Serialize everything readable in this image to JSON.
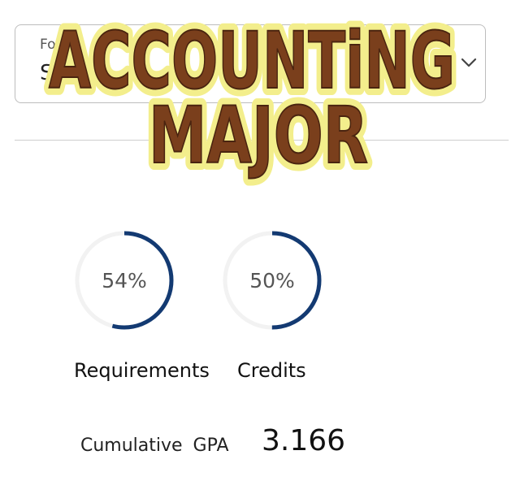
{
  "dropdown": {
    "label_partial": "Fo",
    "value_partial": "S"
  },
  "title": {
    "line1": "ACCOUNTiNG",
    "line2": "MAJOR",
    "fill_color": "#7a3f1c",
    "outline_color": "#f3ee8c"
  },
  "progress": {
    "ring_color": "#133a72",
    "track_color": "#f2f2f2",
    "requirements": {
      "percent_text": "54%",
      "value": 0.54,
      "label": "Requirements"
    },
    "credits": {
      "percent_text": "50%",
      "value": 0.5,
      "label": "Credits"
    }
  },
  "gpa": {
    "label": "Cumulative GPA",
    "value": "3.166"
  }
}
